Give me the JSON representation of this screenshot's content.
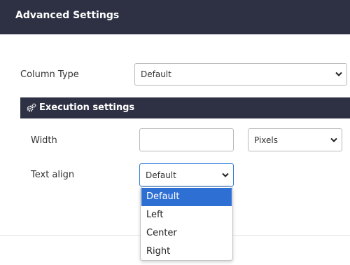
{
  "header": {
    "title": "Advanced Settings"
  },
  "column_type": {
    "label": "Column Type",
    "value": "Default"
  },
  "execution": {
    "title": "Execution settings",
    "width": {
      "label": "Width",
      "value": "",
      "unit": "Pixels"
    },
    "text_align": {
      "label": "Text align",
      "value": "Default",
      "options": [
        "Default",
        "Left",
        "Center",
        "Right"
      ],
      "highlighted": "Default"
    }
  },
  "colors": {
    "header_bg": "#2e3143",
    "highlight": "#2d6fd2",
    "focus_border": "#2d7ad6"
  },
  "icons": {
    "section": "cogs-icon",
    "select_arrow": "chevron-down-icon"
  }
}
